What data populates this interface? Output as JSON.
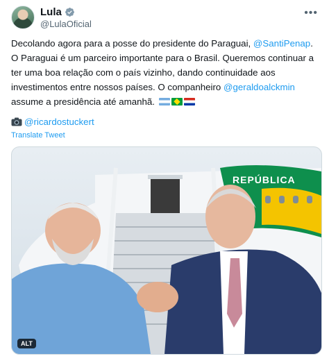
{
  "user": {
    "display_name": "Lula",
    "handle": "@LulaOficial"
  },
  "tweet": {
    "segments": [
      {
        "text": "Decolando agora para a posse do presidente do Paraguai, ",
        "type": "text"
      },
      {
        "text": "@SantiPenap",
        "type": "mention"
      },
      {
        "text": ". O Paraguai é um parceiro importante para o Brasil. Queremos continuar a ter uma boa relação com o país vizinho, dando continuidade aos investimentos entre nossos países. O companheiro ",
        "type": "text"
      },
      {
        "text": "@geraldoalckmin",
        "type": "mention"
      },
      {
        "text": " assume a presidência até amanhã.",
        "type": "text"
      }
    ],
    "flags": [
      "flag-argentina-icon",
      "flag-brazil-icon",
      "flag-paraguay-icon"
    ],
    "photo_credit": "@ricardostuckert",
    "translate_label": "Translate Tweet"
  },
  "media": {
    "alt_label": "ALT",
    "plane_text": "REPÚBLICA"
  },
  "colors": {
    "link": "#1d9bf0",
    "text": "#0f1419",
    "secondary": "#536471"
  }
}
